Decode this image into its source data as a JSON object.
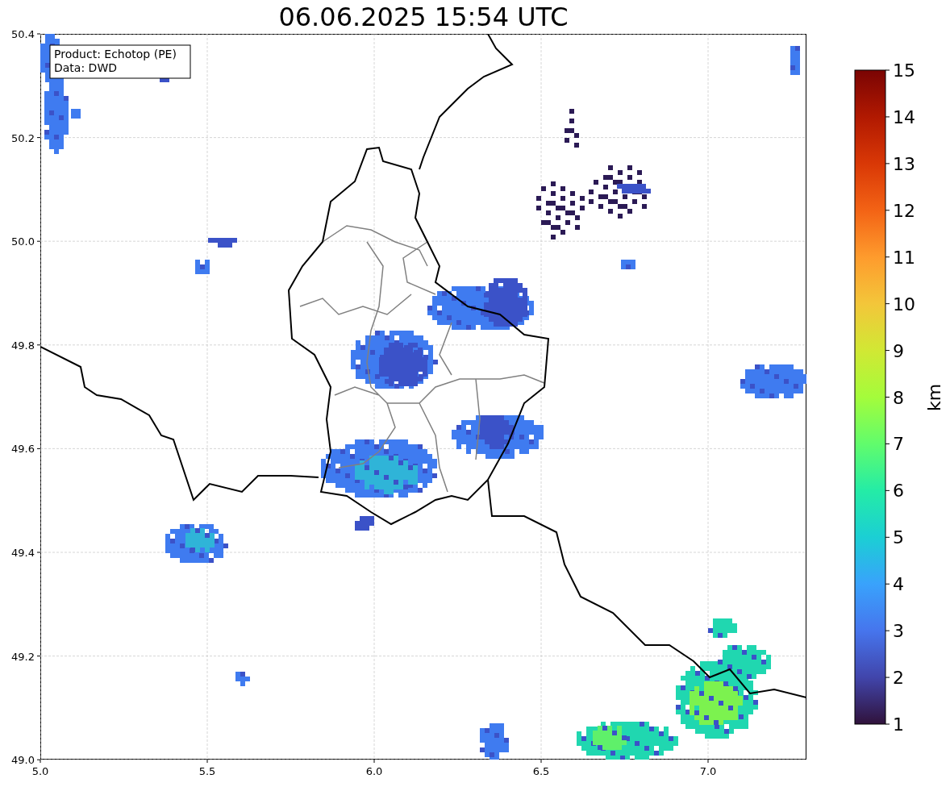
{
  "title": "06.06.2025 15:54 UTC",
  "legend": [
    "Product: Echotop (PE)",
    "Data: DWD"
  ],
  "x_axis": {
    "ticks": [
      "5.0",
      "5.5",
      "6.0",
      "6.5",
      "7.0"
    ]
  },
  "y_axis": {
    "ticks": [
      "50.4",
      "50.2",
      "50.0",
      "49.8",
      "49.6",
      "49.4",
      "49.2",
      "49.0"
    ]
  },
  "colorbar": {
    "label": "km",
    "ticks": [
      "15",
      "14",
      "13",
      "12",
      "11",
      "10",
      "9",
      "8",
      "7",
      "6",
      "5",
      "4",
      "3",
      "2",
      "1"
    ]
  }
}
